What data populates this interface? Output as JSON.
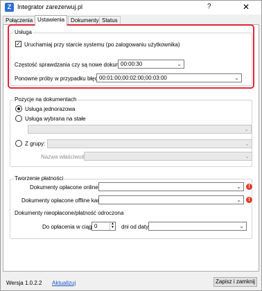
{
  "window": {
    "title": "Integrator zarezerwuj.pl",
    "help_glyph": "?",
    "close_glyph": "✕",
    "app_icon_letter": "Z"
  },
  "tabs": [
    {
      "label": "Połączenia"
    },
    {
      "label": "Ustawienia"
    },
    {
      "label": "Dokumenty"
    },
    {
      "label": "Status"
    }
  ],
  "active_tab": "Ustawienia",
  "usluga": {
    "title": "Usługa",
    "autostart_label": "Uruchamiaj przy starcie systemu (po zalogowaniu użytkownika)",
    "autostart_checked": true,
    "frequency_label": "Częstość sprawdzania czy są nowe dokumenty",
    "frequency_value": "00:00:30",
    "retry_label": "Ponowne próby w przypadku błędu:",
    "retry_value": "00:01:00;00:02:00;00:03:00"
  },
  "pozycje": {
    "title": "Pozycje na dokumentach",
    "option_single": "Usługa jednorazowa",
    "option_fixed": "Usługa wybrana na stałe",
    "option_group": "Z grupy:",
    "property_label": "Nazwa właściwości:",
    "selected": "single"
  },
  "platnosci": {
    "title": "Tworzenie płatności",
    "paid_online_label": "Dokumenty opłacone online:",
    "paid_offline_label": "Dokumenty opłacone offline kartą:",
    "unpaid_label": "Dokumenty nieopłacone/płatność odroczona",
    "pay_within_label": "Do opłacenia w ciągu",
    "pay_within_value": "0",
    "days_label": "dni od daty"
  },
  "footer": {
    "version": "Wersja 1.0.2.2",
    "update_link": "Aktualizuj",
    "save_close": "Zapisz i zamknij"
  },
  "colors": {
    "highlight": "#e0263a",
    "link": "#1a55c8",
    "warning": "#e23c2c"
  }
}
